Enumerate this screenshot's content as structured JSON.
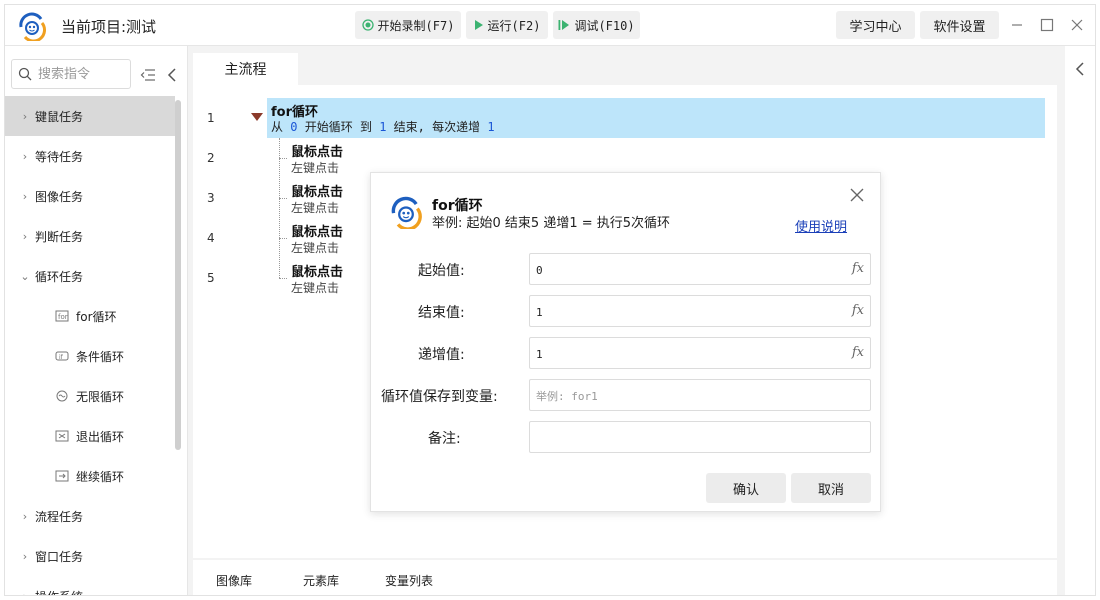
{
  "titlebar": {
    "project_title": "当前项目:测试",
    "record_label": "开始录制(F7)",
    "run_label": "运行(F2)",
    "debug_label": "调试(F10)",
    "learn_center": "学习中心",
    "settings": "软件设置"
  },
  "sidebar": {
    "search_placeholder": "搜索指令",
    "categories": [
      {
        "label": "键鼠任务"
      },
      {
        "label": "等待任务"
      },
      {
        "label": "图像任务"
      },
      {
        "label": "判断任务"
      },
      {
        "label": "循环任务"
      },
      {
        "label": "流程任务"
      },
      {
        "label": "窗口任务"
      },
      {
        "label": "操作系统"
      }
    ],
    "loop_items": [
      {
        "label": "for循环",
        "icon": "for-loop-icon"
      },
      {
        "label": "条件循环",
        "icon": "condition-loop-icon"
      },
      {
        "label": "无限循环",
        "icon": "infinite-loop-icon"
      },
      {
        "label": "退出循环",
        "icon": "exit-loop-icon"
      },
      {
        "label": "继续循环",
        "icon": "continue-loop-icon"
      }
    ]
  },
  "editor": {
    "tab": "主流程",
    "lines": [
      "1",
      "2",
      "3",
      "4",
      "5"
    ],
    "for_block": {
      "title": "for循环",
      "desc_from": "从",
      "start": "0",
      "desc_mid": "开始循环 到",
      "end": "1",
      "desc_tail": "结束, 每次递增",
      "step": "1"
    },
    "children": [
      {
        "title": "鼠标点击",
        "desc": "左键点击"
      },
      {
        "title": "鼠标点击",
        "desc": "左键点击"
      },
      {
        "title": "鼠标点击",
        "desc": "左键点击"
      },
      {
        "title": "鼠标点击",
        "desc": "左键点击"
      }
    ]
  },
  "bottom_tabs": [
    "图像库",
    "元素库",
    "变量列表"
  ],
  "dialog": {
    "title": "for循环",
    "subtitle": "举例: 起始0 结束5 递增1 = 执行5次循环",
    "help_link": "使用说明",
    "fields": {
      "start": {
        "label": "起始值:",
        "value": "0",
        "fx": "fx"
      },
      "end": {
        "label": "结束值:",
        "value": "1",
        "fx": "fx"
      },
      "step": {
        "label": "递增值:",
        "value": "1",
        "fx": "fx"
      },
      "save_var": {
        "label": "循环值保存到变量:",
        "placeholder": "举例: for1"
      },
      "note": {
        "label": "备注:",
        "value": ""
      }
    },
    "confirm": "确认",
    "cancel": "取消"
  },
  "colors": {
    "selected_row_bg": "#bde5fa",
    "number_blue": "#1a56d6",
    "link_blue": "#1a3fb8",
    "run_green": "#3cb371"
  }
}
